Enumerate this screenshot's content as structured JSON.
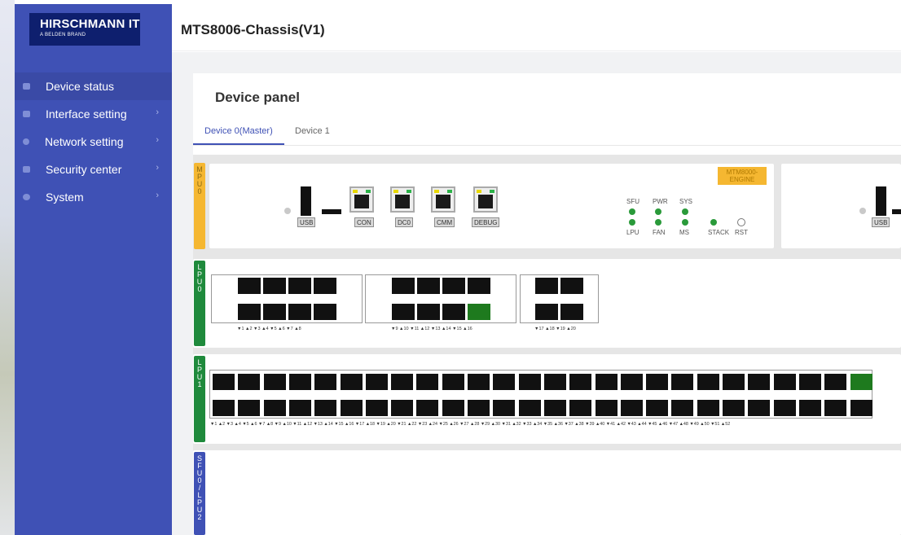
{
  "brand": {
    "name": "HIRSCHMANN IT",
    "tagline": "A BELDEN BRAND"
  },
  "window_title": "MTS8006-Chassis(V1)",
  "nav": [
    {
      "label": "Device status",
      "active": true,
      "has_arrow": false
    },
    {
      "label": "Interface setting",
      "active": false,
      "has_arrow": true
    },
    {
      "label": "Network setting",
      "active": false,
      "has_arrow": true
    },
    {
      "label": "Security center",
      "active": false,
      "has_arrow": true
    },
    {
      "label": "System",
      "active": false,
      "has_arrow": true
    }
  ],
  "panel": {
    "title": "Device panel",
    "tabs": [
      "Device 0(Master)",
      "Device 1"
    ],
    "active_tab": 0
  },
  "mpu": {
    "slot_label": "MPU0",
    "engine_badge": "MTM8000-ENGINE",
    "ports": [
      "USB",
      "CON",
      "DC0",
      "CMM",
      "DEBUG"
    ],
    "leds": [
      "SFU",
      "PWR",
      "SYS",
      "LPU",
      "FAN",
      "MS",
      "STACK",
      "RST"
    ],
    "second_card_port": "USB"
  },
  "lpu0": {
    "slot_label": "LPU0",
    "groups": [
      {
        "labels": "▼1  ▲2 ▼3  ▲4 ▼5  ▲6 ▼7  ▲8",
        "up_ports": []
      },
      {
        "labels": "▼9  ▲10 ▼11 ▲12 ▼13 ▲14 ▼15 ▲16",
        "up_ports": [
          16
        ]
      },
      {
        "labels": "▼17 ▲18 ▼19 ▲20",
        "up_ports": []
      }
    ]
  },
  "lpu1": {
    "slot_label": "LPU1",
    "port_count": 52,
    "up_ports": [
      51
    ],
    "labels": "▼1  ▲2 ▼3  ▲4 ▼5  ▲6 ▼7  ▲8 ▼9  ▲10 ▼11 ▲12 ▼13 ▲14 ▼15 ▲16 ▼17 ▲18 ▼19 ▲20 ▼21 ▲22 ▼23 ▲24 ▼25 ▲26 ▼27 ▲28 ▼29 ▲30 ▼31 ▲32 ▼33 ▲34 ▼35 ▲36 ▼37 ▲38 ▼39 ▲40 ▼41 ▲42 ▼43 ▲44 ▼45 ▲46 ▼47 ▲48 ▼49 ▲50 ▼51 ▲52"
  },
  "sfu": {
    "slot_label": "SFU0/LPU2"
  },
  "colors": {
    "sidebar": "#3f51b5",
    "mpu_tab": "#f5b731",
    "lpu_tab": "#1f8a3c",
    "sfu_tab": "#3f51b5",
    "port_down": "#111111",
    "port_up": "#1e7a1e"
  }
}
